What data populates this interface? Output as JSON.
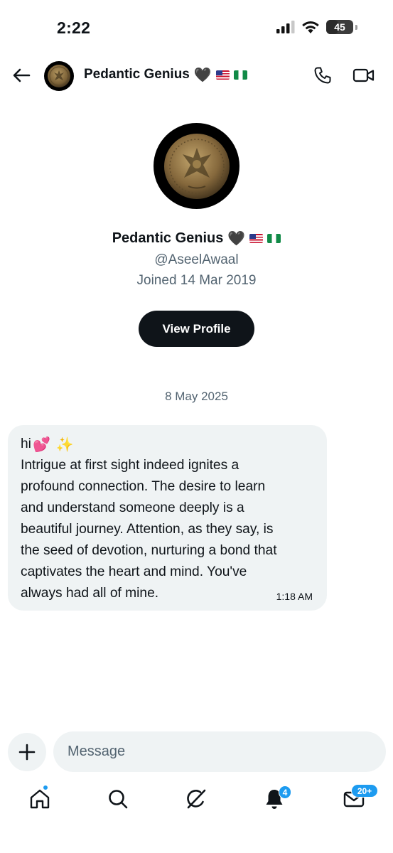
{
  "status_bar": {
    "time": "2:22",
    "battery": "45",
    "battery_fraction": 0.45
  },
  "header": {
    "name": "Pedantic Genius",
    "emoji": "🖤"
  },
  "profile": {
    "name": "Pedantic Genius",
    "emoji": "🖤",
    "handle": "@AseelAwaal",
    "joined": "Joined 14 Mar 2019",
    "view_profile_label": "View Profile"
  },
  "conversation": {
    "date": "8 May 2025",
    "message": {
      "greeting": "hi",
      "greeting_emoji": "💕",
      "sparkles_emoji": "✨",
      "lines": [
        "Intrigue at first sight indeed ignites a",
        "profound connection. The desire to learn",
        "and understand someone deeply is a",
        "beautiful journey. Attention, as they say, is",
        "the seed of devotion, nurturing a bond that",
        "captivates the heart and mind. You've",
        "always had all of mine."
      ],
      "time": "1:18 AM"
    }
  },
  "composer": {
    "placeholder": "Message"
  },
  "tab_bar": {
    "notifications_badge": "4",
    "messages_badge": "20+"
  },
  "icons": {
    "back": "back-arrow-icon",
    "call": "phone-icon",
    "video": "video-camera-icon",
    "add": "plus-icon",
    "home": "home-icon",
    "search": "search-icon",
    "grok": "grok-icon",
    "notifications": "bell-icon",
    "messages": "envelope-icon"
  },
  "colors": {
    "accent": "#1d9bf0",
    "bubble": "#eff3f4",
    "button_dark": "#0f1419",
    "secondary_text": "#536471"
  }
}
